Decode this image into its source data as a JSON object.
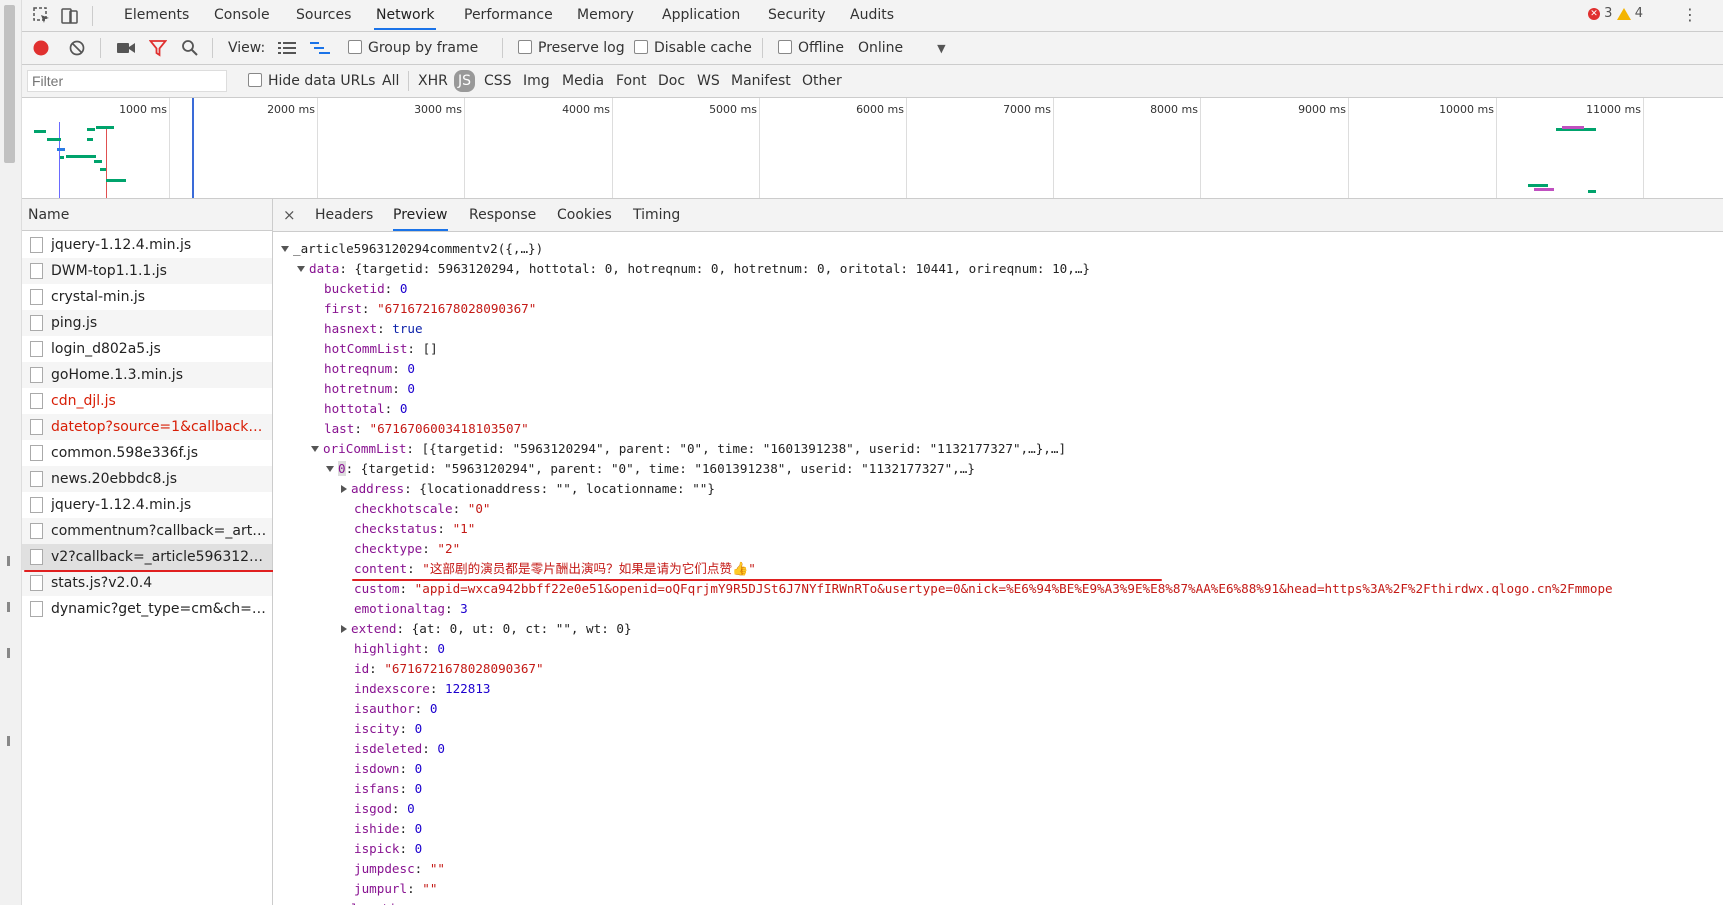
{
  "tabs": {
    "main": [
      "Elements",
      "Console",
      "Sources",
      "Network",
      "Performance",
      "Memory",
      "Application",
      "Security",
      "Audits"
    ],
    "active": "Network",
    "errors": "3",
    "warnings": "4"
  },
  "toolbar": {
    "view_label": "View:",
    "group_by_frame": "Group by frame",
    "preserve_log": "Preserve log",
    "disable_cache": "Disable cache",
    "offline": "Offline",
    "throttle": "Online"
  },
  "filterbar": {
    "placeholder": "Filter",
    "hide_data_urls": "Hide data URLs",
    "types": [
      "All",
      "XHR",
      "JS",
      "CSS",
      "Img",
      "Media",
      "Font",
      "Doc",
      "WS",
      "Manifest",
      "Other"
    ],
    "active_type": "JS"
  },
  "overview": {
    "ticks": [
      "1000 ms",
      "2000 ms",
      "3000 ms",
      "4000 ms",
      "5000 ms",
      "6000 ms",
      "7000 ms",
      "8000 ms",
      "9000 ms",
      "10000 ms",
      "11000 ms"
    ]
  },
  "name_panel": {
    "header": "Name",
    "rows": [
      {
        "name": "jquery-1.12.4.min.js",
        "error": false
      },
      {
        "name": "DWM-top1.1.1.js",
        "error": false
      },
      {
        "name": "crystal-min.js",
        "error": false
      },
      {
        "name": "ping.js",
        "error": false
      },
      {
        "name": "login_d802a5.js",
        "error": false
      },
      {
        "name": "goHome.1.3.min.js",
        "error": false
      },
      {
        "name": "cdn_djl.js",
        "error": true
      },
      {
        "name": "datetop?source=1&callback=...",
        "error": true
      },
      {
        "name": "common.598e336f.js",
        "error": false
      },
      {
        "name": "news.20ebbdc8.js",
        "error": false
      },
      {
        "name": "jquery-1.12.4.min.js",
        "error": false
      },
      {
        "name": "commentnum?callback=_articl...",
        "error": false
      },
      {
        "name": "v2?callback=_article59631202...",
        "error": false
      },
      {
        "name": "stats.js?v2.0.4",
        "error": false
      },
      {
        "name": "dynamic?get_type=cm&ch=co...",
        "error": false
      }
    ],
    "selected_index": 12
  },
  "detail": {
    "close": "×",
    "tabs": [
      "Headers",
      "Preview",
      "Response",
      "Cookies",
      "Timing"
    ],
    "active": "Preview"
  },
  "preview": {
    "root": "_article5963120294commentv2({,…})",
    "data_summary": "{targetid: 5963120294, hottotal: 0, hotreqnum: 0, hotretnum: 0, oritotal: 10441, orireqnum: 10,…}",
    "fields": {
      "bucketid": "0",
      "first": "\"6716721678028090367\"",
      "hasnext": "true",
      "hotCommList": "[]",
      "hotreqnum": "0",
      "hotretnum": "0",
      "hottotal": "0",
      "last": "\"6716706003418103507\""
    },
    "oriCommList_summary": "[{targetid: \"5963120294\", parent: \"0\", time: \"1601391238\", userid: \"1132177327\",…},…]",
    "item0_summary": "{targetid: \"5963120294\", parent: \"0\", time: \"1601391238\", userid: \"1132177327\",…}",
    "item0": {
      "address": "{locationaddress: \"\", locationname: \"\"}",
      "checkhotscale": "\"0\"",
      "checkstatus": "\"1\"",
      "checktype": "\"2\"",
      "content": "\"这部剧的演员都是零片酬出演吗？如果是请为它们点赞",
      "content_end": "\"",
      "custom": "\"appid=wxca942bbff22e0e51&openid=oQFqrjmY9R5DJSt6J7NYfIRWnRTo&usertype=0&nick=%E6%94%BE%E9%A3%9E%E8%87%AA%E6%88%91&head=https%3A%2F%2Fthirdwx.qlogo.cn%2Fmmope",
      "emotionaltag": "3",
      "extend": "{at: 0, ut: 0, ct: \"\", wt: 0}",
      "highlight": "0",
      "id": "\"6716721678028090367\"",
      "indexscore": "122813",
      "isauthor": "0",
      "iscity": "0",
      "isdeleted": "0",
      "isdown": "0",
      "isfans": "0",
      "isgod": "0",
      "ishide": "0",
      "ispick": "0",
      "jumpdesc": "\"\"",
      "jumpurl": "\"\""
    },
    "truncated_key": "location"
  }
}
